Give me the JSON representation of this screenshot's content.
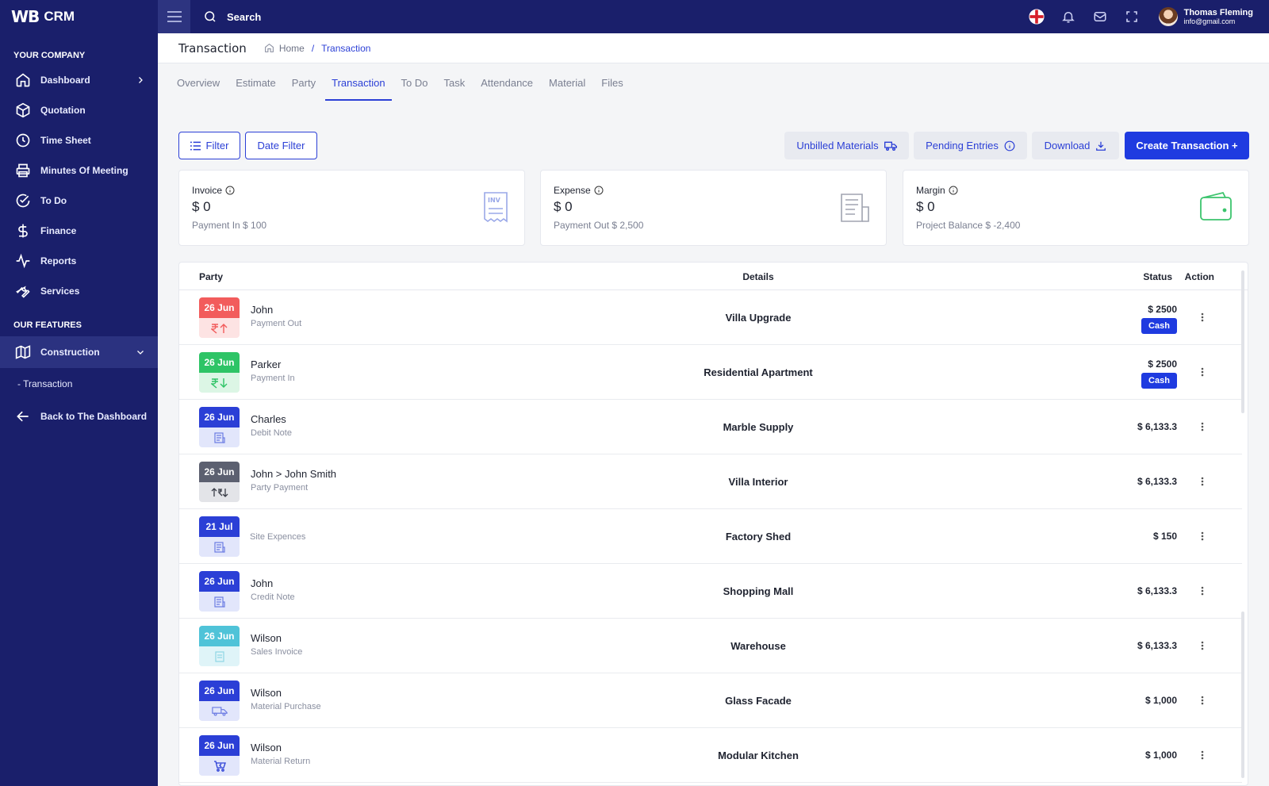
{
  "brand": {
    "logo": "WB",
    "name": "CRM"
  },
  "sidebar": {
    "section1": "YOUR COMPANY",
    "items": [
      {
        "label": "Dashboard",
        "icon": "home-icon"
      },
      {
        "label": "Quotation",
        "icon": "box-icon"
      },
      {
        "label": "Time Sheet",
        "icon": "clock-icon"
      },
      {
        "label": "Minutes Of Meeting",
        "icon": "printer-icon"
      },
      {
        "label": "To Do",
        "icon": "check-circle-icon"
      },
      {
        "label": "Finance",
        "icon": "dollar-icon"
      },
      {
        "label": "Reports",
        "icon": "activity-icon"
      },
      {
        "label": "Services",
        "icon": "wrench-icon"
      }
    ],
    "section2": "OUR FEATURES",
    "construction": "Construction",
    "sub_transaction": "- Transaction",
    "back": "Back to The Dashboard"
  },
  "topbar": {
    "search": "Search",
    "user_name": "Thomas Fleming",
    "user_email": "info@gmail.com"
  },
  "header": {
    "title": "Transaction",
    "crumb_home": "Home",
    "crumb_sep": "/",
    "crumb_current": "Transaction"
  },
  "tabs": [
    "Overview",
    "Estimate",
    "Party",
    "Transaction",
    "To Do",
    "Task",
    "Attendance",
    "Material",
    "Files"
  ],
  "toolbar": {
    "filter": "Filter",
    "date_filter": "Date Filter",
    "unbilled": "Unbilled Materials",
    "pending": "Pending Entries",
    "download": "Download",
    "create": "Create Transaction +"
  },
  "cards": [
    {
      "label": "Invoice",
      "value": "$ 0",
      "sub": "Payment In $ 100"
    },
    {
      "label": "Expense",
      "value": "$ 0",
      "sub": "Payment Out $ 2,500"
    },
    {
      "label": "Margin",
      "value": "$ 0",
      "sub": "Project Balance $ -2,400"
    }
  ],
  "table": {
    "headers": {
      "party": "Party",
      "details": "Details",
      "status": "Status",
      "action": "Action"
    },
    "rows": [
      {
        "date": "26 Jun",
        "name": "John",
        "type": "Payment Out",
        "details": "Villa Upgrade",
        "amount": "$ 2500",
        "badge": "Cash",
        "color": "#f25c5c",
        "tint": "#fde3e3"
      },
      {
        "date": "26 Jun",
        "name": "Parker",
        "type": "Payment In",
        "details": "Residential Apartment",
        "amount": "$ 2500",
        "badge": "Cash",
        "color": "#2ec466",
        "tint": "#dcf6e5"
      },
      {
        "date": "26 Jun",
        "name": "Charles",
        "type": "Debit Note",
        "details": "Marble Supply",
        "amount": "$ 6,133.3",
        "badge": "",
        "color": "#2b3fd6",
        "tint": "#e2e6fb"
      },
      {
        "date": "26 Jun",
        "name": "John > John Smith",
        "type": "Party Payment",
        "details": "Villa Interior",
        "amount": "$ 6,133.3",
        "badge": "",
        "color": "#5c6070",
        "tint": "#e3e4e8"
      },
      {
        "date": "21 Jul",
        "name": "",
        "type": "Site Expences",
        "details": "Factory Shed",
        "amount": "$ 150",
        "badge": "",
        "color": "#2b3fd6",
        "tint": "#e2e6fb"
      },
      {
        "date": "26 Jun",
        "name": "John",
        "type": "Credit Note",
        "details": "Shopping Mall",
        "amount": "$ 6,133.3",
        "badge": "",
        "color": "#2b3fd6",
        "tint": "#e2e6fb"
      },
      {
        "date": "26 Jun",
        "name": "Wilson",
        "type": "Sales Invoice",
        "details": "Warehouse",
        "amount": "$ 6,133.3",
        "badge": "",
        "color": "#4fc3d8",
        "tint": "#dff4f8"
      },
      {
        "date": "26 Jun",
        "name": "Wilson",
        "type": "Material Purchase",
        "details": "Glass Facade",
        "amount": "$ 1,000",
        "badge": "",
        "color": "#2b3fd6",
        "tint": "#e2e6fb"
      },
      {
        "date": "26 Jun",
        "name": "Wilson",
        "type": "Material Return",
        "details": "Modular Kitchen",
        "amount": "$ 1,000",
        "badge": "",
        "color": "#2b3fd6",
        "tint": "#e2e6fb"
      }
    ]
  }
}
